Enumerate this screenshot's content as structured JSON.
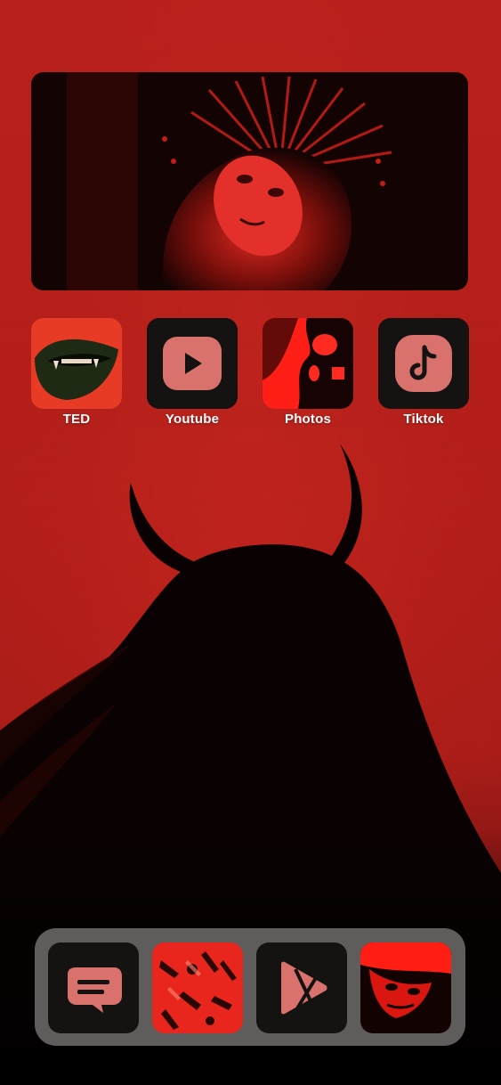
{
  "home_screen": {
    "row1_apps": [
      {
        "label": "TED",
        "icon": "vampire-lips-icon"
      },
      {
        "label": "Youtube",
        "icon": "youtube-icon"
      },
      {
        "label": "Photos",
        "icon": "skull-photo-icon"
      },
      {
        "label": "Tiktok",
        "icon": "tiktok-icon"
      }
    ],
    "dock_apps": [
      {
        "icon": "messages-icon"
      },
      {
        "icon": "hands-artwork-icon"
      },
      {
        "icon": "infuse-play-icon"
      },
      {
        "icon": "red-face-artwork-icon"
      }
    ]
  },
  "colors": {
    "background_red": "#b01f1a",
    "tile_dark": "#151212",
    "dock_gray": "#5f5c5c",
    "icon_pink": "#d9726c"
  }
}
